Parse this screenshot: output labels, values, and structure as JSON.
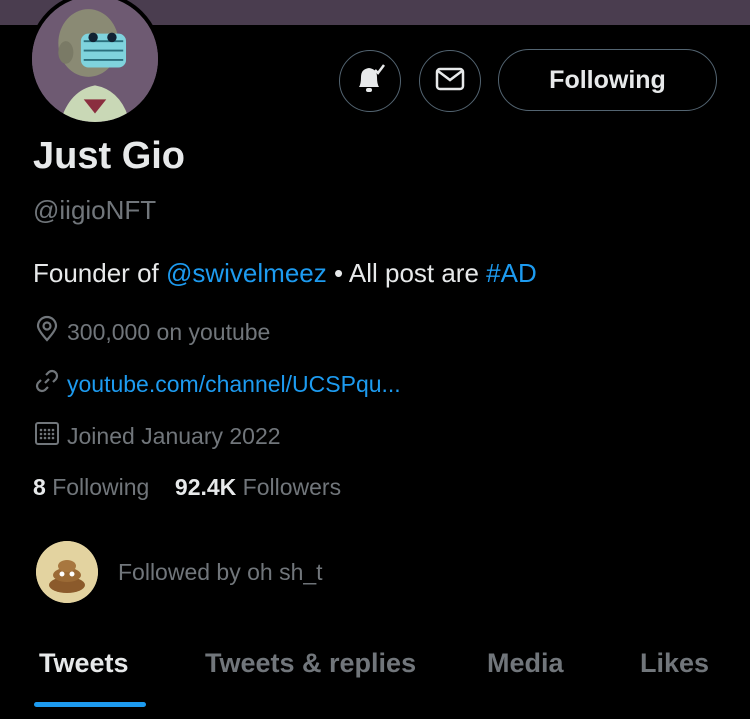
{
  "profile": {
    "name": "Just Gio",
    "handle": "@iigioNFT",
    "bio_prefix": "Founder of ",
    "bio_mention": "@swivelmeez",
    "bio_mid": " • All post are ",
    "bio_hashtag": "#AD",
    "location": "300,000 on youtube",
    "url": "youtube.com/channel/UCSPqu...",
    "joined": "Joined January 2022"
  },
  "actions": {
    "notify_icon": "bell-check-icon",
    "message_icon": "mail-icon",
    "follow_label": "Following"
  },
  "stats": {
    "following_count": "8",
    "following_label": "Following",
    "followers_count": "92.4K",
    "followers_label": "Followers"
  },
  "followed_by": "Followed by oh sh_t",
  "tabs": [
    "Tweets",
    "Tweets & replies",
    "Media",
    "Likes"
  ],
  "colors": {
    "accent": "#1d9bf0",
    "muted": "#71767b",
    "text": "#e7e9ea",
    "background": "#000000"
  }
}
